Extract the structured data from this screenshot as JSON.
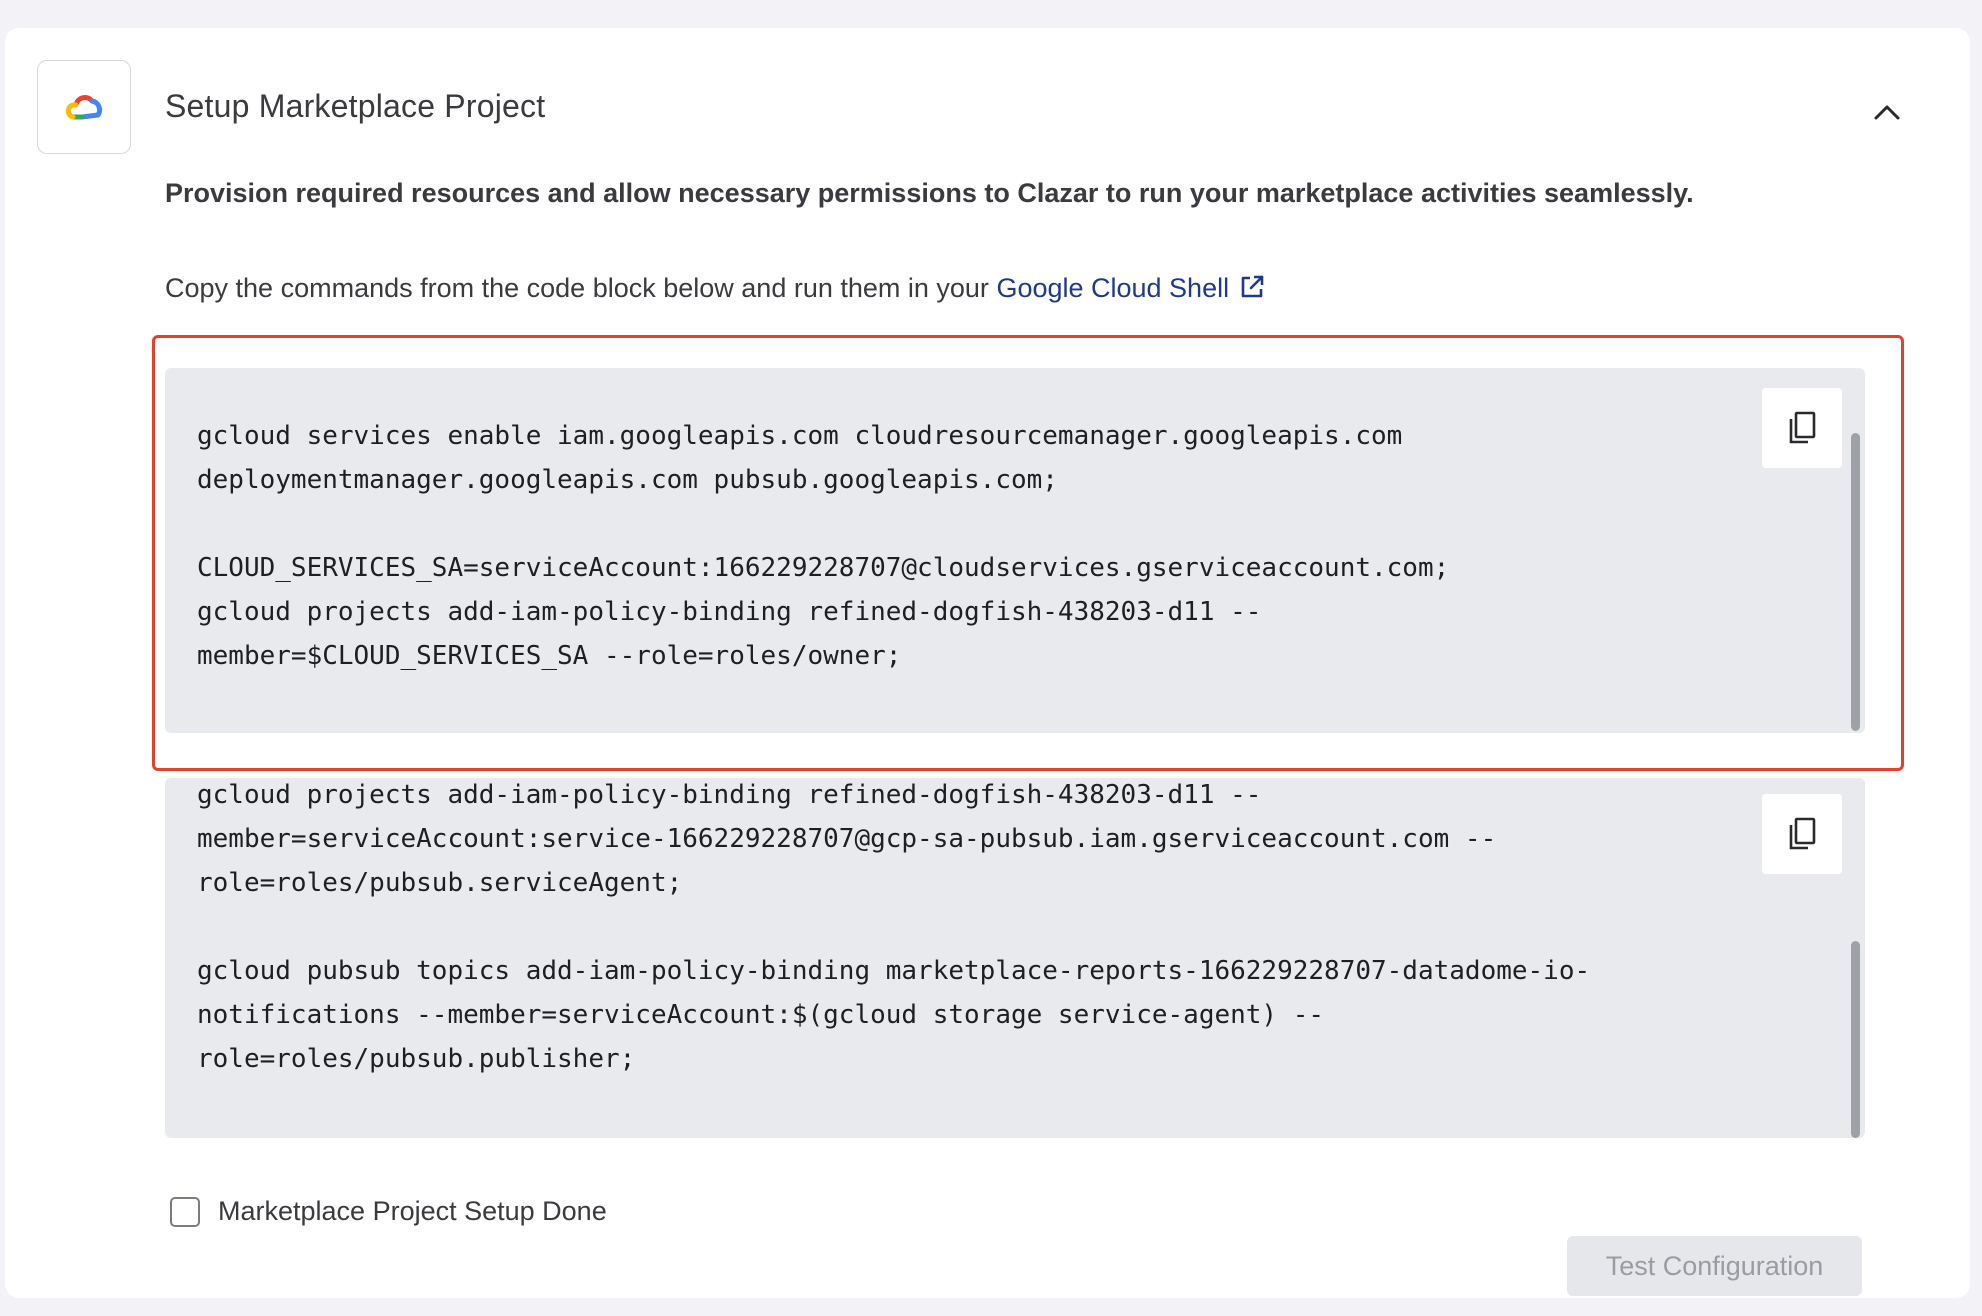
{
  "header": {
    "logo_icon": "google-cloud-icon",
    "title": "Setup Marketplace Project",
    "collapse_icon": "chevron-up-icon"
  },
  "description": "Provision required resources and allow necessary permissions to Clazar to run your marketplace activities seamlessly.",
  "instruction": {
    "text": "Copy the commands from the code block below and run them in your",
    "link_label": "Google Cloud Shell",
    "link_icon": "external-link-icon"
  },
  "code_blocks": [
    {
      "code": "gcloud services enable iam.googleapis.com cloudresourcemanager.googleapis.com\ndeploymentmanager.googleapis.com pubsub.googleapis.com;\n\nCLOUD_SERVICES_SA=serviceAccount:166229228707@cloudservices.gserviceaccount.com;\ngcloud projects add-iam-policy-binding refined-dogfish-438203-d11 --\nmember=$CLOUD_SERVICES_SA --role=roles/owner;",
      "copy_icon": "copy-icon",
      "highlighted": true,
      "highlight_color": "#e3412b"
    },
    {
      "code": "gcloud projects add-iam-policy-binding refined-dogfish-438203-d11 --\nmember=serviceAccount:service-166229228707@gcp-sa-pubsub.iam.gserviceaccount.com --\nrole=roles/pubsub.serviceAgent;\n\ngcloud pubsub topics add-iam-policy-binding marketplace-reports-166229228707-datadome-io-\nnotifications --member=serviceAccount:$(gcloud storage service-agent) --\nrole=roles/pubsub.publisher;",
      "copy_icon": "copy-icon",
      "highlighted": false
    }
  ],
  "checkbox": {
    "label": "Marketplace Project Setup Done",
    "checked": false
  },
  "test_button": {
    "label": "Test Configuration",
    "disabled": true
  },
  "colors": {
    "link": "#1e3a8a",
    "code_background": "#e8eaed",
    "page_background": "#f3f3f7"
  }
}
